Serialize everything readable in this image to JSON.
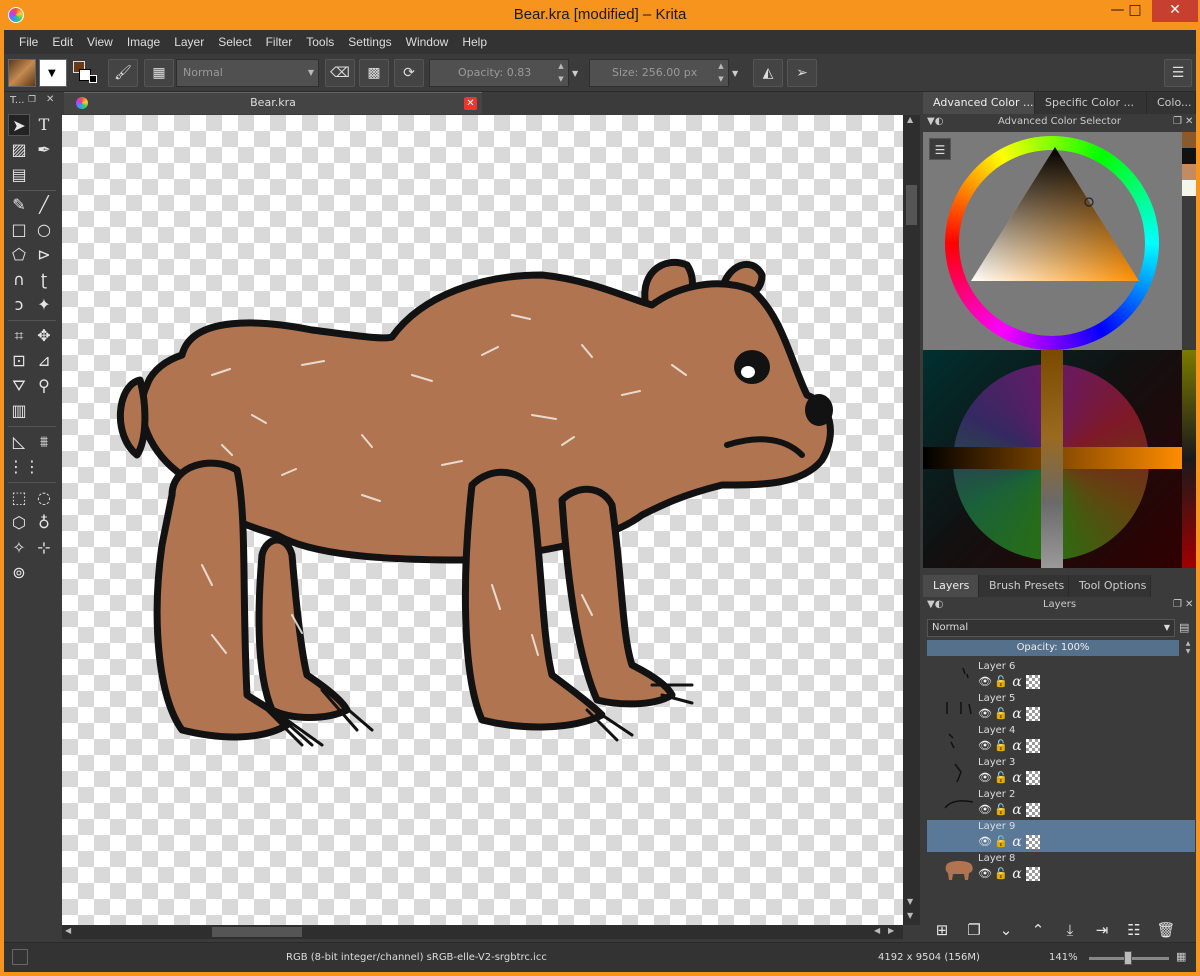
{
  "window": {
    "title": "Bear.kra [modified] – Krita",
    "minimize": "—",
    "maximize": "□",
    "close": "✕"
  },
  "menu": [
    "File",
    "Edit",
    "View",
    "Image",
    "Layer",
    "Select",
    "Filter",
    "Tools",
    "Settings",
    "Window",
    "Help"
  ],
  "toolbar": {
    "blend_mode": "Normal",
    "opacity_label": "Opacity:",
    "opacity_value": "0.83",
    "size_label": "Size:",
    "size_value": "256.00 px",
    "foreground_color": "#8a5a2b",
    "background_color": "#ffffff"
  },
  "toolbox": {
    "header": "T..."
  },
  "document": {
    "tab_label": "Bear.kra",
    "canvas_description_color": "#b07550"
  },
  "dockers": {
    "color_tabs": [
      "Advanced Color ...",
      "Specific Color ...",
      "Colo..."
    ],
    "color_panel_title": "Advanced Color Selector",
    "recent_colors": [
      "#8a5a2b",
      "#111111",
      "#c48a60",
      "#f5f5e8"
    ],
    "layer_tabs": [
      "Layers",
      "Brush Presets",
      "Tool Options"
    ],
    "layers_panel_title": "Layers",
    "blend_mode": "Normal",
    "opacity": "Opacity:  100%"
  },
  "layers": [
    {
      "name": "Layer 6",
      "selected": false
    },
    {
      "name": "Layer 5",
      "selected": false
    },
    {
      "name": "Layer 4",
      "selected": false
    },
    {
      "name": "Layer 3",
      "selected": false
    },
    {
      "name": "Layer 2",
      "selected": false
    },
    {
      "name": "Layer 9",
      "selected": true
    },
    {
      "name": "Layer 8",
      "selected": false
    }
  ],
  "statusbar": {
    "colorspace": "RGB (8-bit integer/channel)  sRGB-elle-V2-srgbtrc.icc",
    "dimensions": "4192 x 9504 (156M)",
    "zoom": "141%"
  }
}
